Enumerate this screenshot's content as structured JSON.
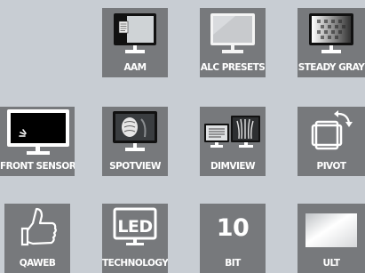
{
  "tiles": [
    {
      "id": "aam",
      "label": "AAM",
      "icon": "monitor-document-icon"
    },
    {
      "id": "alc_presets",
      "label": "ALC PRESETS",
      "icon": "monitor-blank-icon"
    },
    {
      "id": "steady_gray",
      "label": "STEADY GRAY",
      "icon": "monitor-grayscale-gradient-icon"
    },
    {
      "id": "front_sensor",
      "label": "FRONT SENSOR",
      "icon": "monitor-sensor-icon"
    },
    {
      "id": "spotview",
      "label": "SPOTVIEW",
      "icon": "monitor-xray-spot-icon"
    },
    {
      "id": "dimview",
      "label": "DIMVIEW",
      "icon": "dual-monitor-xray-icon"
    },
    {
      "id": "pivot",
      "label": "PIVOT",
      "icon": "rotate-screen-icon"
    },
    {
      "id": "qaweb",
      "label": "QAWEB",
      "icon": "thumbs-up-icon"
    },
    {
      "id": "technology",
      "label": "TECHNOLOGY",
      "icon": "led-monitor-icon",
      "icon_text": "LED"
    },
    {
      "id": "bit",
      "label": "BIT",
      "icon": "ten-bit-icon",
      "icon_text": "10"
    },
    {
      "id": "ult",
      "label": "ULT",
      "icon": "white-square-icon"
    }
  ],
  "colors": {
    "background": "#c8cdd3",
    "tile": "#77797c",
    "label_text": "#ffffff"
  }
}
